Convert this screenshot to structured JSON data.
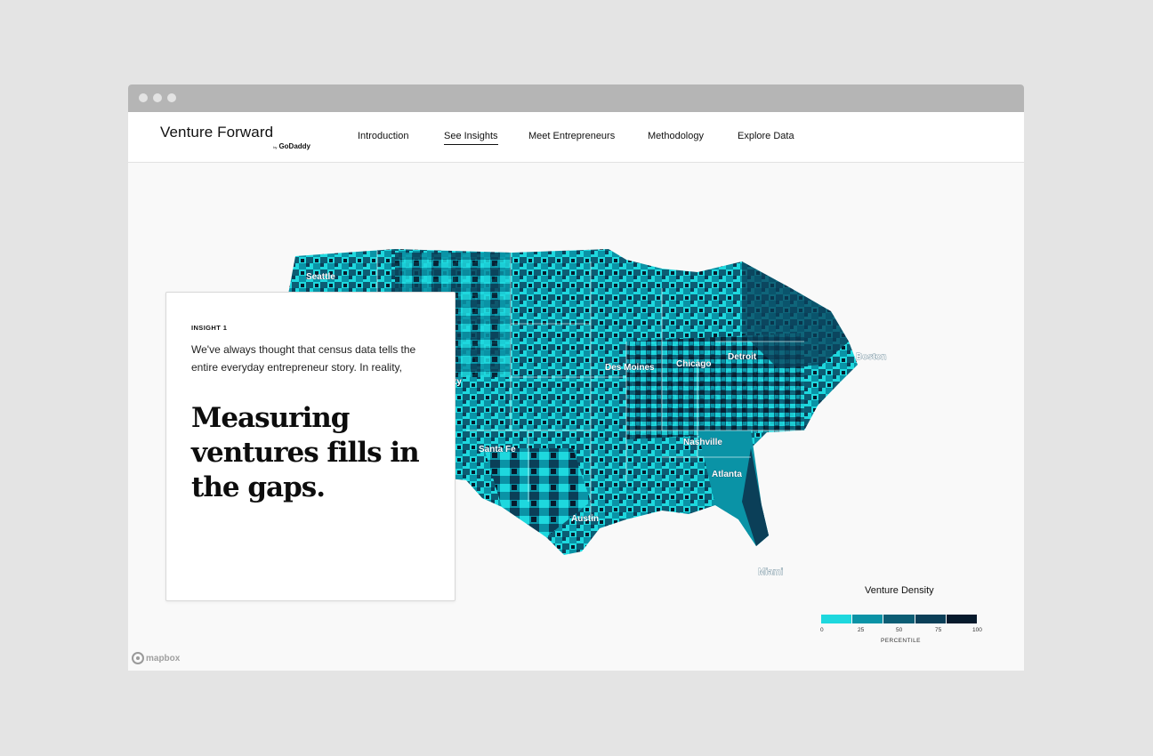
{
  "brand": {
    "name": "Venture Forward",
    "by": "by",
    "company": "GoDaddy"
  },
  "nav": [
    {
      "label": "Introduction",
      "active": false
    },
    {
      "label": "See Insights",
      "active": true
    },
    {
      "label": "Meet Entrepreneurs",
      "active": false
    },
    {
      "label": "Methodology",
      "active": false
    },
    {
      "label": "Explore Data",
      "active": false
    }
  ],
  "insight": {
    "eyebrow": "INSIGHT 1",
    "intro": "We've always thought that census data tells the entire everyday entrepreneur story. In reality,",
    "headline": "Measuring ventures fills in the gaps."
  },
  "map": {
    "cities": [
      "Seattle",
      "Des Moines",
      "Chicago",
      "Detroit",
      "Boston",
      "Santa Fe",
      "Nashville",
      "Atlanta",
      "Austin",
      "Miami"
    ],
    "partial_label": "ty",
    "attribution": "mapbox"
  },
  "legend": {
    "title": "Venture Density",
    "ticks": [
      "0",
      "25",
      "50",
      "75",
      "100"
    ],
    "unit": "PERCENTILE",
    "colors": [
      "#1ed8de",
      "#0a93a6",
      "#0c5d74",
      "#0b3f58",
      "#071a2c"
    ]
  },
  "colors": {
    "accent": "#1ed8de",
    "dark": "#0b3f58",
    "background": "#f9f9f9"
  }
}
